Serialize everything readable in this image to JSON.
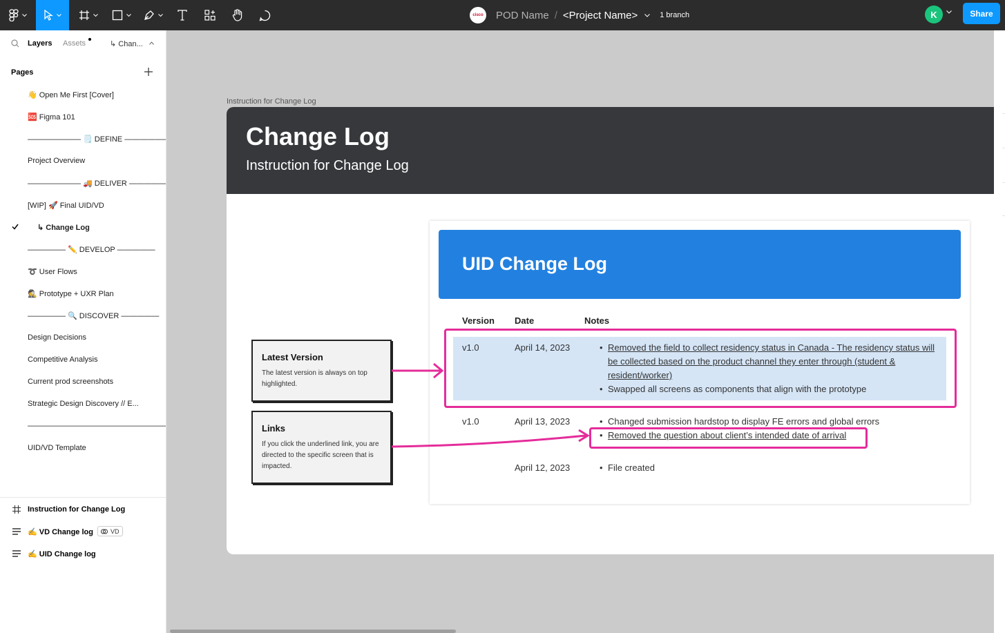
{
  "toolbar": {
    "tools": [
      "figma-menu",
      "move-tool",
      "frame-tool",
      "shape-tool",
      "pen-tool",
      "text-tool",
      "resources-tool",
      "hand-tool",
      "comment-tool"
    ],
    "cisco_logo_text": "cisco",
    "pod_name": "POD Name",
    "separator": "/",
    "project_name": "<Project Name>",
    "branch": "1 branch",
    "avatar_initial": "K",
    "share_label": "Share",
    "accent_color": "#0d99ff"
  },
  "left_panel": {
    "tabs": {
      "layers": "Layers",
      "assets": "Assets",
      "page_switch": "↳ Chan..."
    },
    "pages_label": "Pages",
    "pages": [
      {
        "label": "👋 Open Me First [Cover]"
      },
      {
        "label": "🆘 Figma 101"
      },
      {
        "label": "——————— 🗒️ DEFINE ———————"
      },
      {
        "label": "Project Overview"
      },
      {
        "label": "——————— 🚚 DELIVER ———————"
      },
      {
        "label": "[WIP] 🚀 Final UID/VD"
      },
      {
        "label": "↳ Change Log",
        "current": true
      },
      {
        "label": "————— ✏️ DEVELOP —————"
      },
      {
        "label": "➰ User Flows"
      },
      {
        "label": "🕵️ Prototype + UXR Plan"
      },
      {
        "label": "————— 🔍 DISCOVER —————"
      },
      {
        "label": "Design Decisions"
      },
      {
        "label": "Competitive Analysis"
      },
      {
        "label": "Current prod screenshots"
      },
      {
        "label": "Strategic Design Discovery // E..."
      },
      {
        "label": "————————————————————"
      },
      {
        "label": "UID/VD Template"
      }
    ],
    "layers": [
      {
        "label": "Instruction for Change Log",
        "icon": "frame-icon"
      },
      {
        "label": "✍️ VD Change log",
        "icon": "text-layer-icon",
        "badge": "VD"
      },
      {
        "label": "✍️ UID Change log",
        "icon": "text-layer-icon"
      }
    ]
  },
  "canvas": {
    "frame_label": "Instruction for Change Log",
    "frame_title": "Change Log",
    "frame_subtitle": "Instruction for Change Log",
    "cards": [
      {
        "title": "Latest Version",
        "text": "The latest version is always on top highlighted."
      },
      {
        "title": "Links",
        "text": "If you click the underlined link, you are directed to the specific screen that is impacted."
      }
    ],
    "uid": {
      "title": "UID Change Log",
      "columns": [
        "Version",
        "Date",
        "Notes"
      ],
      "rows": [
        {
          "version": "v1.0",
          "date": "April 14, 2023",
          "notes": [
            "Removed the field to collect residency status in Canada - The residency status will be collected based on the product channel they enter through (student & resident/worker)",
            "Swapped all screens as components that align with the prototype"
          ]
        },
        {
          "version": "v1.0",
          "date": "April 13, 2023",
          "notes": [
            "Changed submission hardstop to display FE errors and global errors",
            "Removed the question about client’s intended date of arrival"
          ]
        },
        {
          "version": "",
          "date": "April 12, 2023",
          "notes": [
            "File created"
          ]
        }
      ]
    },
    "annotation_color": "#e52c9a",
    "header_color": "#2281e0"
  }
}
